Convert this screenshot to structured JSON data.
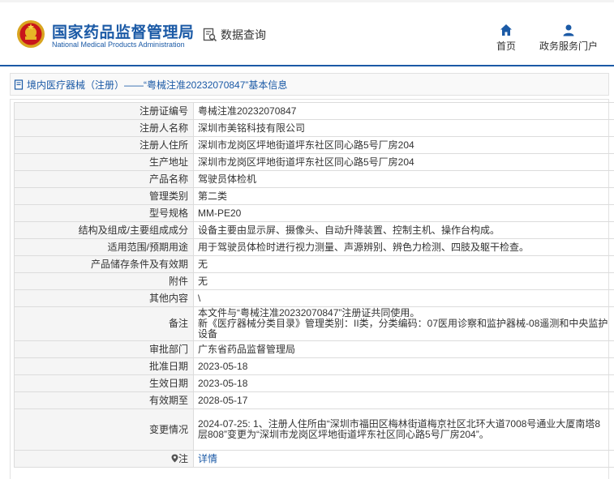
{
  "site": {
    "name_cn": "国家药品监督管理局",
    "name_en": "National Medical Products Administration",
    "data_query": "数据查询",
    "nav": [
      {
        "label": "首页",
        "icon": "home-icon"
      },
      {
        "label": "政务服务门户",
        "icon": "user-icon"
      }
    ],
    "accent": "#1b5aa6"
  },
  "breadcrumb": {
    "text": "境内医疗器械（注册）——“粤械注准20232070847”基本信息"
  },
  "details": [
    {
      "key": "注册证编号",
      "value": "粤械注准20232070847"
    },
    {
      "key": "注册人名称",
      "value": "深圳市美铭科技有限公司"
    },
    {
      "key": "注册人住所",
      "value": "深圳市龙岗区坪地街道坪东社区同心路5号厂房204"
    },
    {
      "key": "生产地址",
      "value": "深圳市龙岗区坪地街道坪东社区同心路5号厂房204"
    },
    {
      "key": "产品名称",
      "value": "驾驶员体检机"
    },
    {
      "key": "管理类别",
      "value": "第二类"
    },
    {
      "key": "型号规格",
      "value": "MM-PE20"
    },
    {
      "key": "结构及组成/主要组成成分",
      "value": "设备主要由显示屏、摄像头、自动升降装置、控制主机、操作台构成。"
    },
    {
      "key": "适用范围/预期用途",
      "value": "用于驾驶员体检时进行视力测量、声源辨别、辨色力检测、四肢及躯干检查。"
    },
    {
      "key": "产品储存条件及有效期",
      "value": "无"
    },
    {
      "key": "附件",
      "value": "无"
    },
    {
      "key": "其他内容",
      "value": "\\"
    },
    {
      "key": "备注",
      "value": "本文件与“粤械注准20232070847”注册证共同使用。",
      "value2": "新《医疗器械分类目录》管理类别：II类，分类编码：07医用诊察和监护器械-08遥测和中央监护设备"
    },
    {
      "key": "审批部门",
      "value": "广东省药品监督管理局"
    },
    {
      "key": "批准日期",
      "value": "2023-05-18"
    },
    {
      "key": "生效日期",
      "value": "2023-05-18"
    },
    {
      "key": "有效期至",
      "value": "2028-05-17"
    },
    {
      "key": "变更情况",
      "value": "2024-07-25: 1、注册人住所由“深圳市福田区梅林街道梅京社区北环大道7008号通业大厦南塔8层808”变更为“深圳市龙岗区坪地街道坪东社区同心路5号厂房204”。"
    },
    {
      "key": "注",
      "value": "详情"
    }
  ]
}
